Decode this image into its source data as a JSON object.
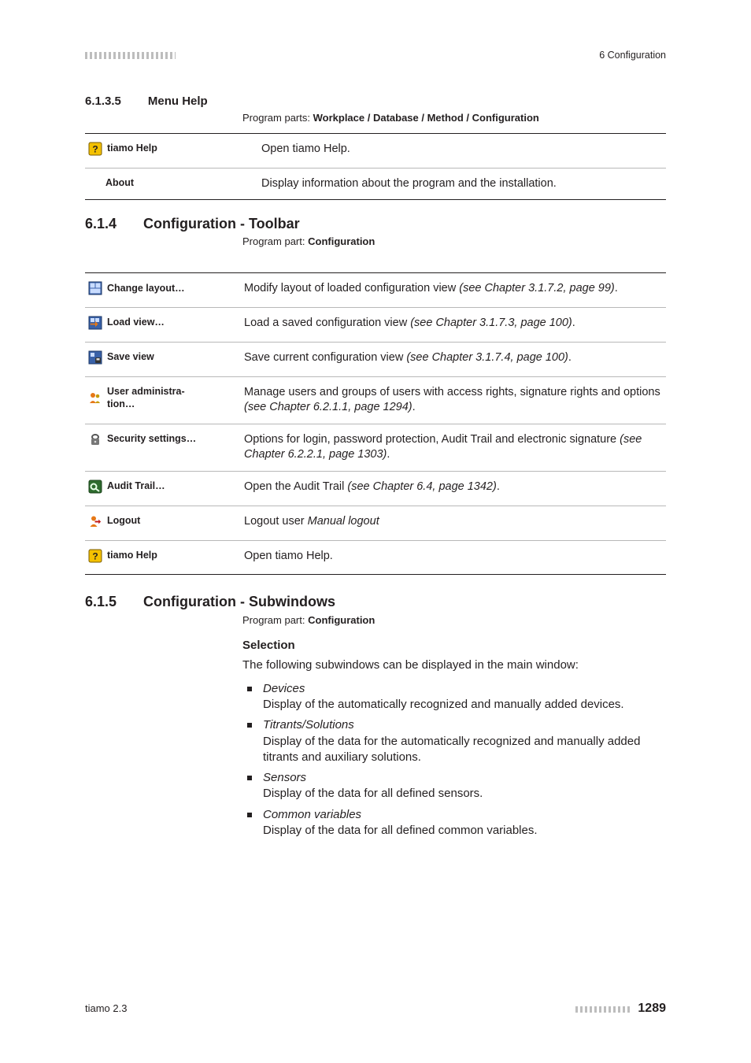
{
  "header": {
    "right": "6 Configuration"
  },
  "s6135": {
    "num": "6.1.3.5",
    "title": "Menu Help",
    "program_label": "Program parts:",
    "program_value": "Workplace / Database / Method / Configuration",
    "rows": [
      {
        "icon": "help",
        "label": "tiamo Help",
        "desc": "Open tiamo Help."
      },
      {
        "icon": "",
        "label": "About",
        "desc": "Display information about the program and the installation."
      }
    ]
  },
  "s614": {
    "num": "6.1.4",
    "title": "Configuration - Toolbar",
    "program_label": "Program part:",
    "program_value": "Configuration",
    "rows": [
      {
        "icon": "layout",
        "label": "Change layout…",
        "desc_pre": "Modify layout of loaded configuration view ",
        "ital": "(see Chapter 3.1.7.2, page 99)",
        "desc_post": "."
      },
      {
        "icon": "load",
        "label": "Load view…",
        "desc_pre": "Load a saved configuration view ",
        "ital": "(see Chapter 3.1.7.3, page 100)",
        "desc_post": "."
      },
      {
        "icon": "save",
        "label": "Save view",
        "desc_pre": "Save current configuration view ",
        "ital": "(see Chapter 3.1.7.4, page 100)",
        "desc_post": "."
      },
      {
        "icon": "users",
        "label": "User administra-\ntion…",
        "desc_pre": "Manage users and groups of users with access rights, signature rights and options ",
        "ital": "(see Chapter 6.2.1.1, page 1294)",
        "desc_post": "."
      },
      {
        "icon": "security",
        "label": "Security settings…",
        "desc_pre": "Options for login, password protection, Audit Trail and electronic signature ",
        "ital": "(see Chapter 6.2.2.1, page 1303)",
        "desc_post": "."
      },
      {
        "icon": "audit",
        "label": "Audit Trail…",
        "desc_pre": "Open the Audit Trail ",
        "ital": "(see Chapter 6.4, page 1342)",
        "desc_post": "."
      },
      {
        "icon": "logout",
        "label": "Logout",
        "desc_pre": "Logout user ",
        "ital": "Manual logout",
        "desc_post": ""
      },
      {
        "icon": "help",
        "label": "tiamo Help",
        "desc_pre": "Open tiamo Help.",
        "ital": "",
        "desc_post": ""
      }
    ]
  },
  "s615": {
    "num": "6.1.5",
    "title": "Configuration - Subwindows",
    "program_label": "Program part:",
    "program_value": "Configuration",
    "selection_head": "Selection",
    "intro": "The following subwindows can be displayed in the main window:",
    "items": [
      {
        "term": "Devices",
        "desc": "Display of the automatically recognized and manually added devices."
      },
      {
        "term": "Titrants/Solutions",
        "desc": "Display of the data for the automatically recognized and manually added titrants and auxiliary solutions."
      },
      {
        "term": "Sensors",
        "desc": "Display of the data for all defined sensors."
      },
      {
        "term": "Common variables",
        "desc": "Display of the data for all defined common variables."
      }
    ]
  },
  "footer": {
    "left": "tiamo 2.3",
    "page": "1289"
  }
}
